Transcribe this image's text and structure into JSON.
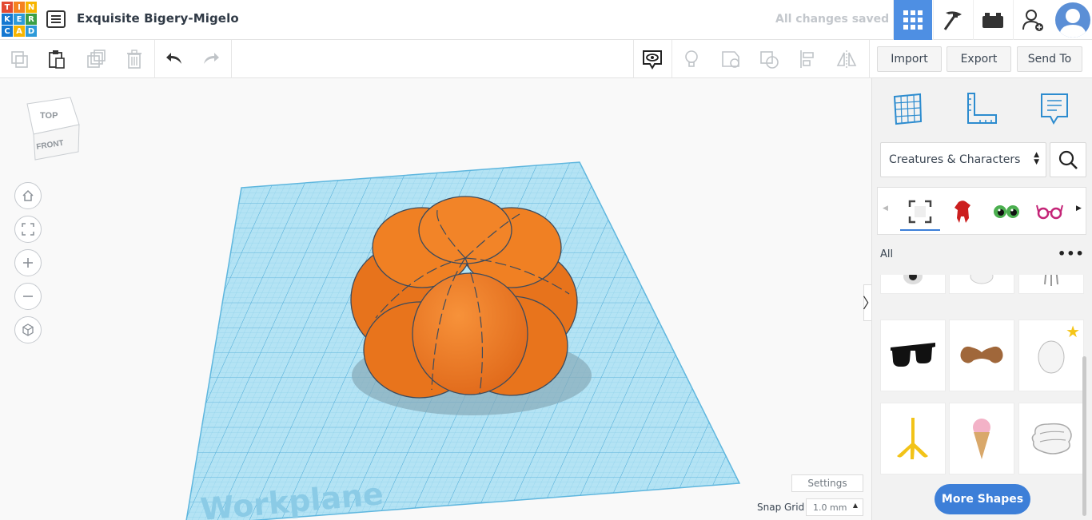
{
  "header": {
    "logo_letters": [
      "T",
      "I",
      "N",
      "K",
      "E",
      "R",
      "C",
      "A",
      "D"
    ],
    "design_title": "Exquisite Bigery-Migelo",
    "save_status": "All changes saved",
    "icons": [
      "grid-view-icon",
      "pickaxe-icon",
      "brick-icon",
      "add-user-icon",
      "user-avatar"
    ]
  },
  "toolbar": {
    "edit_icons": [
      "copy-icon",
      "paste-icon",
      "duplicate-icon",
      "delete-icon",
      "undo-icon",
      "redo-icon"
    ],
    "view_icons": [
      "notes-toggle-icon",
      "hint-icon",
      "shape-group-icon",
      "ungroup-icon",
      "align-icon",
      "mirror-icon"
    ],
    "import_label": "Import",
    "export_label": "Export",
    "send_to_label": "Send To"
  },
  "viewport": {
    "viewcube_top": "TOP",
    "viewcube_front": "FRONT",
    "workplane_label": "Workplane",
    "settings_label": "Settings",
    "snap_grid_label": "Snap Grid",
    "snap_grid_value": "1.0 mm",
    "colors": {
      "workplane": "#aee2f5",
      "grid_line": "#5cb8df",
      "shape": "#f07f1b",
      "shape_shade": "#d9661a"
    }
  },
  "panel": {
    "tools": [
      "workplane-tool-icon",
      "ruler-tool-icon",
      "notes-tool-icon"
    ],
    "category": "Creatures & Characters",
    "all_label": "All",
    "more_shapes_label": "More Shapes",
    "accent": "#3d7fd8"
  }
}
